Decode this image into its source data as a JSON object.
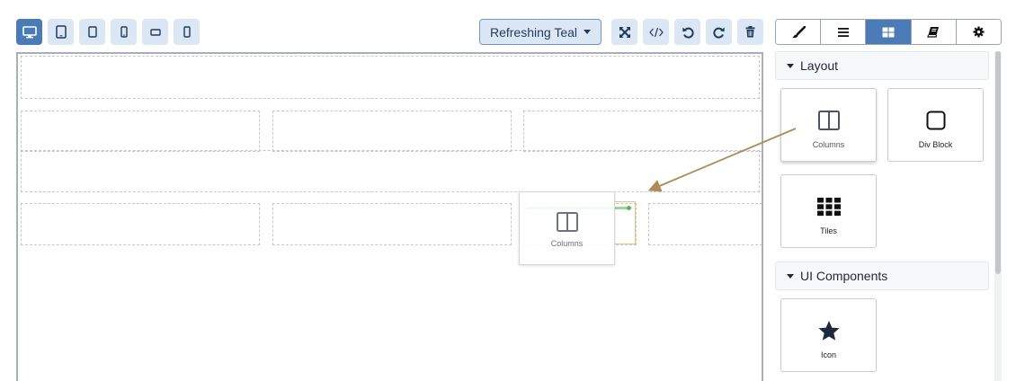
{
  "toolbar": {
    "devices": [
      {
        "name": "desktop",
        "icon": "desktop-icon",
        "active": true
      },
      {
        "name": "tablet",
        "icon": "tablet-icon",
        "active": false
      },
      {
        "name": "tablet-small",
        "icon": "tablet-small-icon",
        "active": false
      },
      {
        "name": "mobile",
        "icon": "mobile-icon",
        "active": false
      },
      {
        "name": "mobile-landscape",
        "icon": "mobile-landscape-icon",
        "active": false
      },
      {
        "name": "mobile-small",
        "icon": "mobile-small-icon",
        "active": false
      }
    ],
    "theme": {
      "selected": "Refreshing Teal"
    },
    "actions": [
      {
        "name": "fullscreen",
        "icon": "expand-icon"
      },
      {
        "name": "code",
        "icon": "code-icon"
      },
      {
        "name": "undo",
        "icon": "undo-icon"
      },
      {
        "name": "redo",
        "icon": "redo-icon"
      },
      {
        "name": "delete",
        "icon": "trash-icon"
      }
    ]
  },
  "panel_tabs": [
    {
      "name": "style-manager",
      "icon": "paint-brush-icon",
      "active": false
    },
    {
      "name": "layer-manager",
      "icon": "bars-icon",
      "active": false
    },
    {
      "name": "blocks",
      "icon": "grid-icon",
      "active": true
    },
    {
      "name": "pages",
      "icon": "book-icon",
      "active": false
    },
    {
      "name": "settings",
      "icon": "gear-icon",
      "active": false
    }
  ],
  "blocks_panel": {
    "sections": [
      {
        "title": "Layout",
        "blocks": [
          {
            "label": "Columns",
            "icon": "columns-icon"
          },
          {
            "label": "Div Block",
            "icon": "square-icon"
          },
          {
            "label": "Tiles",
            "icon": "tiles-icon"
          }
        ]
      },
      {
        "title": "UI Components",
        "blocks": [
          {
            "label": "Icon",
            "icon": "star-icon"
          }
        ]
      }
    ]
  },
  "drag": {
    "ghost_label": "Columns",
    "ghost_icon": "columns-icon",
    "arrow_color": "#b08a55",
    "placeholder_color": "#5fb35f"
  },
  "colors": {
    "accent": "#4a7bb7",
    "button_bg": "#dbe7f5",
    "dashed": "#c4c8cc"
  }
}
